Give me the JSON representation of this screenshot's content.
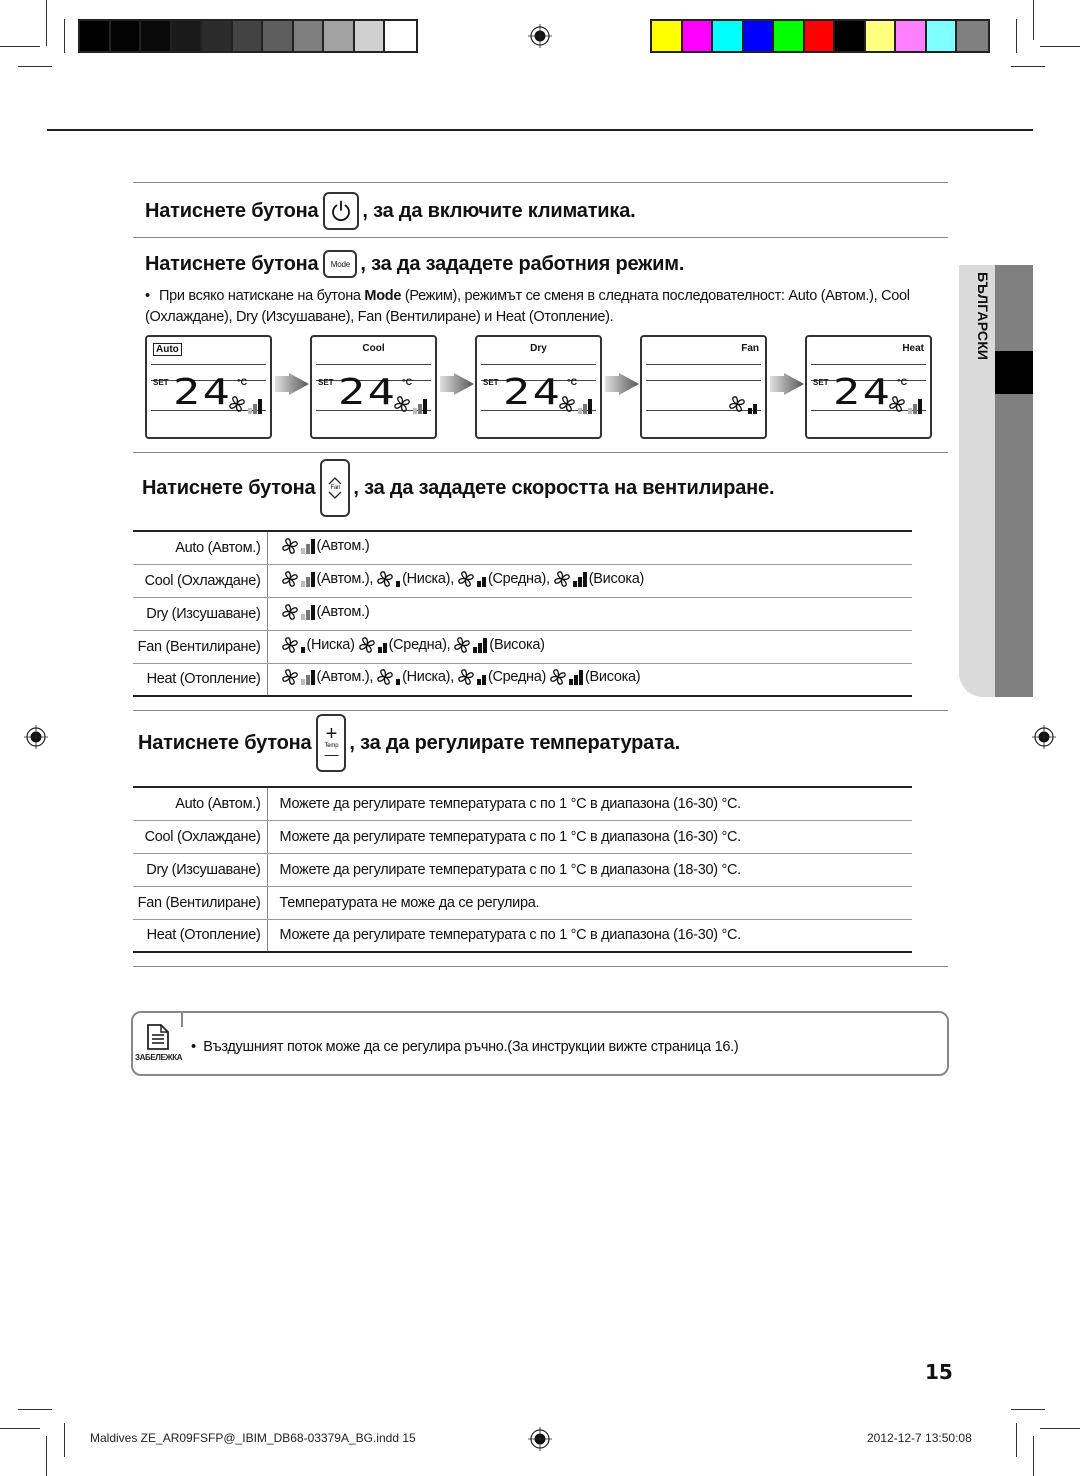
{
  "print_marks": {
    "grayscale_bar": [
      "#000000",
      "#030303",
      "#0a0a0a",
      "#1a1a1a",
      "#2b2b2b",
      "#434343",
      "#5e5e5e",
      "#7f7f7f",
      "#a2a2a2",
      "#d0d0d0",
      "#ffffff"
    ],
    "color_bar": [
      "#ffff00",
      "#ff00ff",
      "#00ffff",
      "#0000ff",
      "#00ff00",
      "#ff0000",
      "#000000",
      "#ffff80",
      "#ff80ff",
      "#80ffff",
      "#808080"
    ]
  },
  "sections": {
    "power": {
      "text_before": "Натиснете бутона",
      "button_icon": "power-icon",
      "text_after": ", за да включите климатика."
    },
    "mode": {
      "text_before": "Натиснете бутона",
      "button_label": "Mode",
      "text_after": ", за да зададете работния режим.",
      "bullet": {
        "part1": "При всяко натискане на бутона ",
        "bold": "Mode",
        "part2": " (Режим), режимът се сменя в следната последователност: Auto (Автом.), Cool (Охлаждане), Dry (Изсушаване), Fan (Вентилиране) и Heat (Отопление)."
      },
      "displays": [
        {
          "mode": "Auto",
          "set_label": "SET",
          "temp": "24",
          "unit": "°C",
          "fan_level": "auto",
          "show_temp": true
        },
        {
          "mode": "Cool",
          "set_label": "SET",
          "temp": "24",
          "unit": "°C",
          "fan_level": "auto",
          "show_temp": true
        },
        {
          "mode": "Dry",
          "set_label": "SET",
          "temp": "24",
          "unit": "°C",
          "fan_level": "auto",
          "show_temp": true
        },
        {
          "mode": "Fan",
          "set_label": "",
          "temp": "",
          "unit": "",
          "fan_level": "medium",
          "show_temp": false
        },
        {
          "mode": "Heat",
          "set_label": "SET",
          "temp": "24",
          "unit": "°C",
          "fan_level": "auto",
          "show_temp": true
        }
      ]
    },
    "fan": {
      "text_before": "Натиснете бутона",
      "button_label": "Fan",
      "text_after": ", за да зададете скоростта на вентилиране.",
      "rows": [
        {
          "mode": "Auto (Автом.)",
          "speeds": [
            {
              "level": "auto",
              "label": "(Автом.)"
            }
          ]
        },
        {
          "mode": "Cool (Охлаждане)",
          "speeds": [
            {
              "level": "auto",
              "label": "(Автом.),"
            },
            {
              "level": "low",
              "label": "(Ниска),"
            },
            {
              "level": "medium",
              "label": "(Средна),"
            },
            {
              "level": "high",
              "label": "(Висока)"
            }
          ]
        },
        {
          "mode": "Dry (Изсушаване)",
          "speeds": [
            {
              "level": "auto",
              "label": "(Автом.)"
            }
          ]
        },
        {
          "mode": "Fan (Вентилиране)",
          "speeds": [
            {
              "level": "low",
              "label": "(Ниска)"
            },
            {
              "level": "medium",
              "label": "(Средна),"
            },
            {
              "level": "high",
              "label": "(Висока)"
            }
          ]
        },
        {
          "mode": "Heat (Отопление)",
          "speeds": [
            {
              "level": "auto",
              "label": "(Автом.),"
            },
            {
              "level": "low",
              "label": "(Ниска),"
            },
            {
              "level": "medium",
              "label": "(Средна)"
            },
            {
              "level": "high",
              "label": "(Висока)"
            }
          ]
        }
      ]
    },
    "temp": {
      "text_before": "Натиснете бутона",
      "button_label": "Temp",
      "button_plus": "+",
      "button_minus": "—",
      "text_after": ", за да регулирате температурата.",
      "rows": [
        {
          "mode": "Auto (Автом.)",
          "desc": "Можете да регулирате температурата с по 1 °C в диапазона (16-30) °C."
        },
        {
          "mode": "Cool (Охлаждане)",
          "desc": "Можете да регулирате температурата с по 1 °C в диапазона (16-30) °C."
        },
        {
          "mode": "Dry (Изсушаване)",
          "desc": "Можете да регулирате температурата с по 1 °C в диапазона (18-30) °C."
        },
        {
          "mode": "Fan (Вентилиране)",
          "desc": "Температурата не може да се регулира."
        },
        {
          "mode": "Heat (Отопление)",
          "desc": "Можете да регулирате температурата с по 1 °C в диапазона (16-30) °C."
        }
      ]
    }
  },
  "note": {
    "icon": "note-document-icon",
    "icon_label": "ЗАБЕЛЕЖКА",
    "text": "Въздушният поток може да се регулира ръчно.(За инструкции вижте страница 16.)"
  },
  "side_tab": {
    "label": "БЪЛГАРСКИ"
  },
  "page_number": "15",
  "footer": {
    "file": "Maldives ZE_AR09FSFP@_IBIM_DB68-03379A_BG.indd   15",
    "datetime": "2012-12-7   13:50:08"
  }
}
